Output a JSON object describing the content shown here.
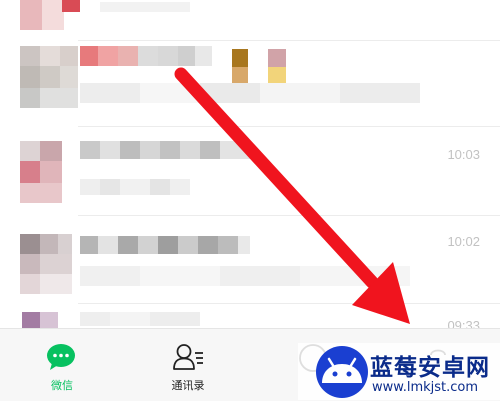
{
  "chat_list": {
    "rows": [
      {
        "time": ""
      },
      {
        "time": ""
      },
      {
        "time": "10:03"
      },
      {
        "time": "10:02"
      },
      {
        "time": "09:33"
      }
    ]
  },
  "tab_bar": {
    "tabs": [
      {
        "label": "微信",
        "icon": "chat-bubble-icon",
        "active": true
      },
      {
        "label": "通讯录",
        "icon": "contacts-icon",
        "active": false
      },
      {
        "label": "",
        "icon": "discover-icon",
        "active": false
      },
      {
        "label": "",
        "icon": "me-icon",
        "active": false
      }
    ]
  },
  "annotation": {
    "type": "red-arrow",
    "color": "#f0141e"
  },
  "watermark": {
    "name": "蓝莓安卓网",
    "url": "www.lmkjst.com",
    "logo_color": "#1a3fd1"
  },
  "colors": {
    "accent": "#07c160",
    "background": "#ffffff",
    "tab_bar": "#f7f7f7"
  }
}
